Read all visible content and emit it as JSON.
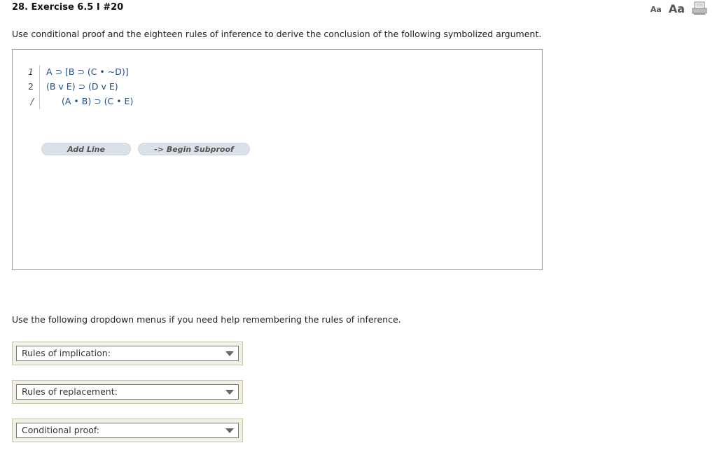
{
  "header": {
    "title": "28. Exercise 6.5 I #20",
    "font_small": "Aa",
    "font_large": "Aa",
    "print_icon": "print-icon"
  },
  "instructions": "Use conditional proof and the eighteen rules of inference to derive the conclusion of the following symbolized argument.",
  "proof": {
    "lines": [
      {
        "num": "1",
        "formula": "A ⊃ [B ⊃ (C • ~D)]"
      },
      {
        "num": "2",
        "formula": "(B v E) ⊃ (D v E)"
      },
      {
        "num": "/",
        "formula": "(A • B) ⊃ (C • E)"
      }
    ],
    "add_line_label": "Add Line",
    "begin_subproof_label": "-> Begin Subproof"
  },
  "dropdown_help": "Use the following dropdown menus if you need help remembering the rules of inference.",
  "dropdowns": [
    {
      "label": "Rules of implication:"
    },
    {
      "label": "Rules of replacement:"
    },
    {
      "label": "Conditional proof:"
    }
  ]
}
